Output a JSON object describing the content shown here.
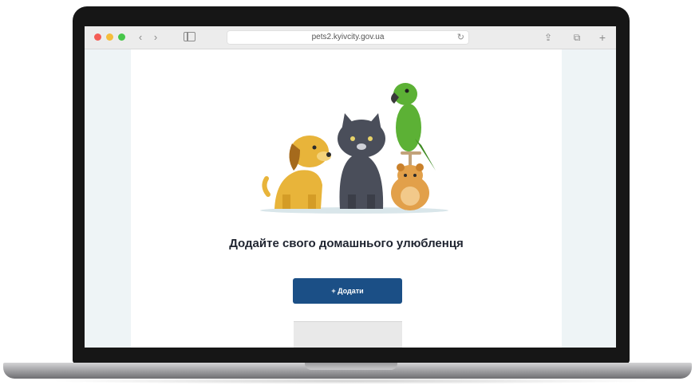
{
  "browser": {
    "url": "pets2.kyivcity.gov.ua",
    "reload_icon": "reload-icon",
    "nav_back": "‹",
    "nav_forward": "›",
    "share_glyph": "⇪",
    "tabs_glyph": "⧉",
    "new_tab_glyph": "+"
  },
  "page": {
    "title": "Додайте свого домашнього улюбленця",
    "subtitle": "",
    "add_button_label": "+ Додати",
    "below_button_text": "",
    "dropdown_items": [
      "",
      ""
    ]
  },
  "colors": {
    "button": "#1b4f86",
    "page_background": "#eef4f6",
    "dog": "#e8b43a",
    "cat": "#4a4e5a",
    "parrot": "#5cb135",
    "hamster": "#e2a04a"
  },
  "icons": [
    "close-window-icon",
    "minimize-window-icon",
    "maximize-window-icon",
    "back-arrow-icon",
    "forward-arrow-icon",
    "sidebar-icon",
    "reload-icon",
    "share-icon",
    "tabs-icon",
    "new-tab-icon"
  ]
}
